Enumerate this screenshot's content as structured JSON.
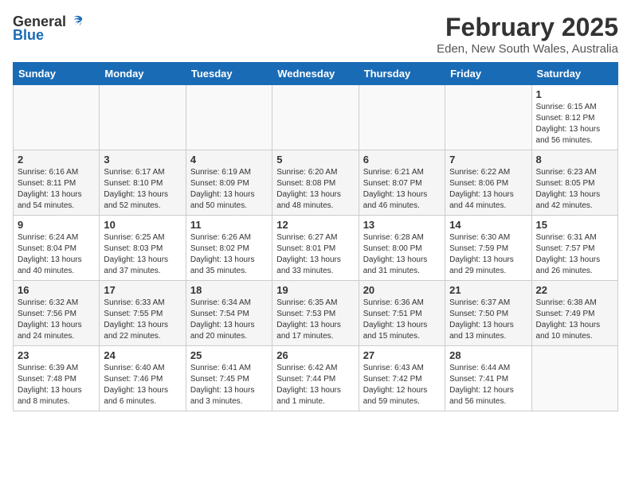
{
  "header": {
    "logo_general": "General",
    "logo_blue": "Blue",
    "month": "February 2025",
    "location": "Eden, New South Wales, Australia"
  },
  "weekdays": [
    "Sunday",
    "Monday",
    "Tuesday",
    "Wednesday",
    "Thursday",
    "Friday",
    "Saturday"
  ],
  "weeks": [
    [
      {
        "day": "",
        "info": ""
      },
      {
        "day": "",
        "info": ""
      },
      {
        "day": "",
        "info": ""
      },
      {
        "day": "",
        "info": ""
      },
      {
        "day": "",
        "info": ""
      },
      {
        "day": "",
        "info": ""
      },
      {
        "day": "1",
        "info": "Sunrise: 6:15 AM\nSunset: 8:12 PM\nDaylight: 13 hours\nand 56 minutes."
      }
    ],
    [
      {
        "day": "2",
        "info": "Sunrise: 6:16 AM\nSunset: 8:11 PM\nDaylight: 13 hours\nand 54 minutes."
      },
      {
        "day": "3",
        "info": "Sunrise: 6:17 AM\nSunset: 8:10 PM\nDaylight: 13 hours\nand 52 minutes."
      },
      {
        "day": "4",
        "info": "Sunrise: 6:19 AM\nSunset: 8:09 PM\nDaylight: 13 hours\nand 50 minutes."
      },
      {
        "day": "5",
        "info": "Sunrise: 6:20 AM\nSunset: 8:08 PM\nDaylight: 13 hours\nand 48 minutes."
      },
      {
        "day": "6",
        "info": "Sunrise: 6:21 AM\nSunset: 8:07 PM\nDaylight: 13 hours\nand 46 minutes."
      },
      {
        "day": "7",
        "info": "Sunrise: 6:22 AM\nSunset: 8:06 PM\nDaylight: 13 hours\nand 44 minutes."
      },
      {
        "day": "8",
        "info": "Sunrise: 6:23 AM\nSunset: 8:05 PM\nDaylight: 13 hours\nand 42 minutes."
      }
    ],
    [
      {
        "day": "9",
        "info": "Sunrise: 6:24 AM\nSunset: 8:04 PM\nDaylight: 13 hours\nand 40 minutes."
      },
      {
        "day": "10",
        "info": "Sunrise: 6:25 AM\nSunset: 8:03 PM\nDaylight: 13 hours\nand 37 minutes."
      },
      {
        "day": "11",
        "info": "Sunrise: 6:26 AM\nSunset: 8:02 PM\nDaylight: 13 hours\nand 35 minutes."
      },
      {
        "day": "12",
        "info": "Sunrise: 6:27 AM\nSunset: 8:01 PM\nDaylight: 13 hours\nand 33 minutes."
      },
      {
        "day": "13",
        "info": "Sunrise: 6:28 AM\nSunset: 8:00 PM\nDaylight: 13 hours\nand 31 minutes."
      },
      {
        "day": "14",
        "info": "Sunrise: 6:30 AM\nSunset: 7:59 PM\nDaylight: 13 hours\nand 29 minutes."
      },
      {
        "day": "15",
        "info": "Sunrise: 6:31 AM\nSunset: 7:57 PM\nDaylight: 13 hours\nand 26 minutes."
      }
    ],
    [
      {
        "day": "16",
        "info": "Sunrise: 6:32 AM\nSunset: 7:56 PM\nDaylight: 13 hours\nand 24 minutes."
      },
      {
        "day": "17",
        "info": "Sunrise: 6:33 AM\nSunset: 7:55 PM\nDaylight: 13 hours\nand 22 minutes."
      },
      {
        "day": "18",
        "info": "Sunrise: 6:34 AM\nSunset: 7:54 PM\nDaylight: 13 hours\nand 20 minutes."
      },
      {
        "day": "19",
        "info": "Sunrise: 6:35 AM\nSunset: 7:53 PM\nDaylight: 13 hours\nand 17 minutes."
      },
      {
        "day": "20",
        "info": "Sunrise: 6:36 AM\nSunset: 7:51 PM\nDaylight: 13 hours\nand 15 minutes."
      },
      {
        "day": "21",
        "info": "Sunrise: 6:37 AM\nSunset: 7:50 PM\nDaylight: 13 hours\nand 13 minutes."
      },
      {
        "day": "22",
        "info": "Sunrise: 6:38 AM\nSunset: 7:49 PM\nDaylight: 13 hours\nand 10 minutes."
      }
    ],
    [
      {
        "day": "23",
        "info": "Sunrise: 6:39 AM\nSunset: 7:48 PM\nDaylight: 13 hours\nand 8 minutes."
      },
      {
        "day": "24",
        "info": "Sunrise: 6:40 AM\nSunset: 7:46 PM\nDaylight: 13 hours\nand 6 minutes."
      },
      {
        "day": "25",
        "info": "Sunrise: 6:41 AM\nSunset: 7:45 PM\nDaylight: 13 hours\nand 3 minutes."
      },
      {
        "day": "26",
        "info": "Sunrise: 6:42 AM\nSunset: 7:44 PM\nDaylight: 13 hours\nand 1 minute."
      },
      {
        "day": "27",
        "info": "Sunrise: 6:43 AM\nSunset: 7:42 PM\nDaylight: 12 hours\nand 59 minutes."
      },
      {
        "day": "28",
        "info": "Sunrise: 6:44 AM\nSunset: 7:41 PM\nDaylight: 12 hours\nand 56 minutes."
      },
      {
        "day": "",
        "info": ""
      }
    ]
  ]
}
